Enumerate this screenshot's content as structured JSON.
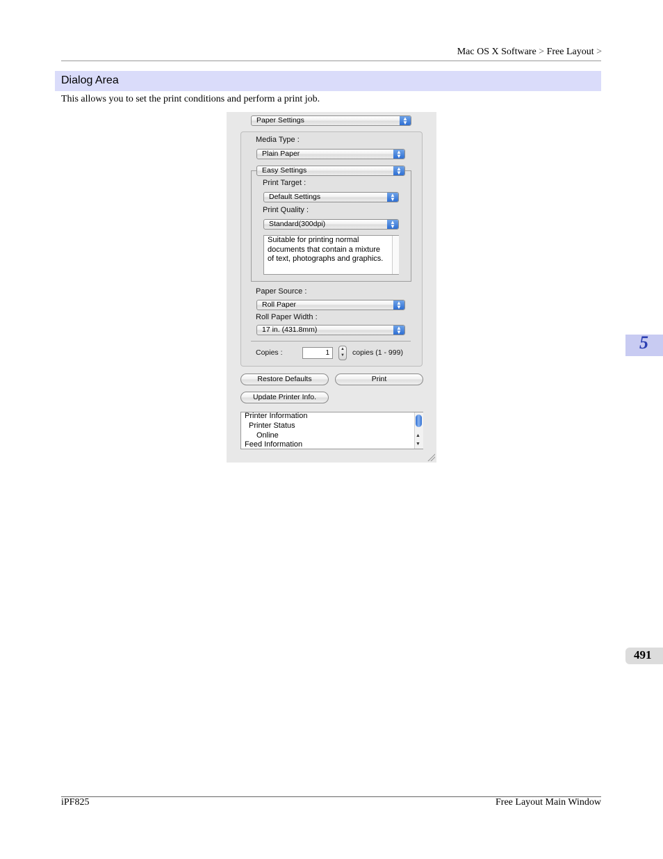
{
  "header": {
    "breadcrumb": [
      "Mac OS X Software",
      "Free Layout"
    ],
    "separator": ">"
  },
  "section": {
    "title": "Dialog Area",
    "intro": "This allows you to set the print conditions and perform a print job."
  },
  "side_tabs": {
    "chapter": "5",
    "page": "491"
  },
  "dialog": {
    "settings_popup": "Paper Settings",
    "media_type_label": "Media Type :",
    "media_type_value": "Plain Paper",
    "mode_popup": "Easy Settings",
    "print_target_label": "Print Target :",
    "print_target_value": "Default Settings",
    "print_quality_label": "Print Quality :",
    "print_quality_value": "Standard(300dpi)",
    "description": "Suitable for printing normal documents that contain a mixture of text, photographs and graphics.",
    "paper_source_label": "Paper Source :",
    "paper_source_value": "Roll Paper",
    "roll_width_label": "Roll Paper Width :",
    "roll_width_value": "17 in. (431.8mm)",
    "copies_label": "Copies :",
    "copies_value": "1",
    "copies_range": "copies (1 - 999)",
    "restore_button": "Restore Defaults",
    "print_button": "Print",
    "update_button": "Update Printer Info.",
    "info_lines": [
      "Printer Information",
      "Printer Status",
      "Online",
      "Feed Information"
    ]
  },
  "footer": {
    "left": "iPF825",
    "right": "Free Layout Main Window"
  },
  "colors": {
    "section_bar": "#dadcfa",
    "chapter_tab": "#c8cbf2",
    "chapter_number": "#2b3fb3",
    "popup_arrow": "#2f6fd3"
  }
}
